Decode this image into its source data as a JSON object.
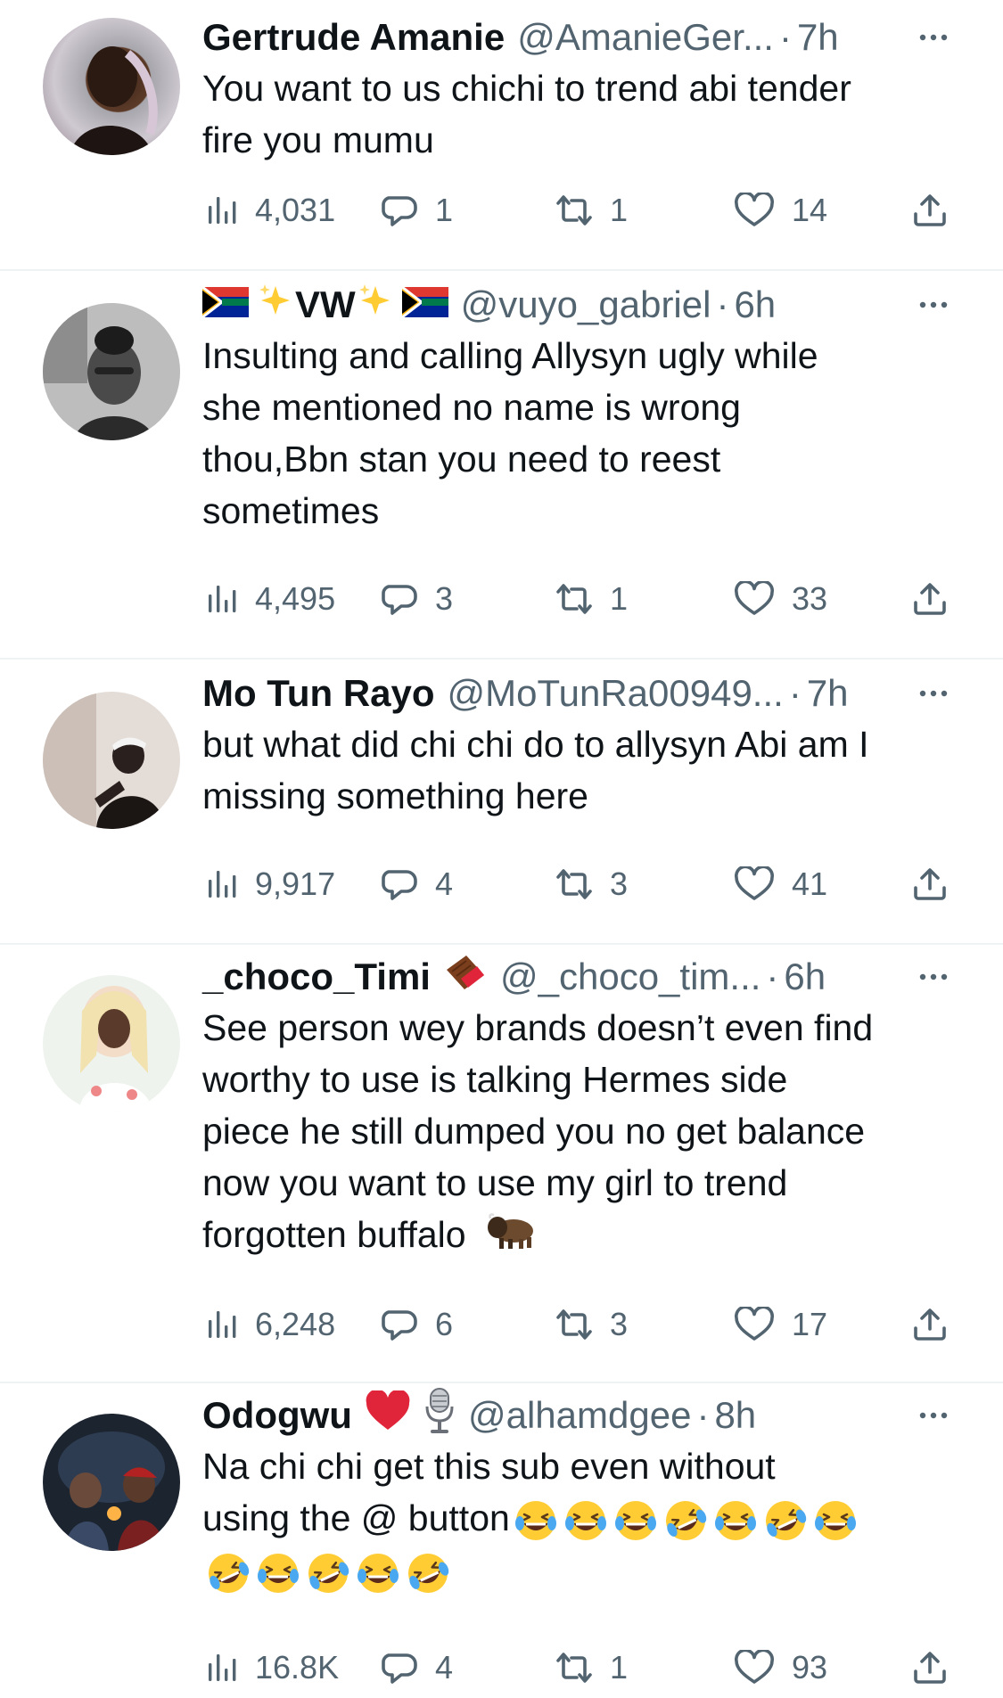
{
  "tweets": [
    {
      "name": "Gertrude Amanie",
      "handle": "@AmanieGer...",
      "time": "7h",
      "text": [
        "You want to us chichi to trend abi tender",
        "fire you mumu"
      ],
      "views": "4,031",
      "replies": "1",
      "retweets": "1",
      "likes": "14"
    },
    {
      "name": "VW",
      "handle": "@vuyo_gabriel",
      "time": "6h",
      "text": [
        "Insulting and calling Allysyn ugly while",
        "she mentioned no name is wrong",
        "thou,Bbn stan you need to reest",
        "sometimes"
      ],
      "views": "4,495",
      "replies": "3",
      "retweets": "1",
      "likes": "33"
    },
    {
      "name": "Mo Tun Rayo",
      "handle": "@MoTunRa00949...",
      "time": "7h",
      "text": [
        "but what did chi chi do to allysyn Abi am I",
        "missing something here"
      ],
      "views": "9,917",
      "replies": "4",
      "retweets": "3",
      "likes": "41"
    },
    {
      "name": "_choco_Timi",
      "handle": "@_choco_tim...",
      "time": "6h",
      "text": [
        "See person wey brands doesn’t even find",
        "worthy to use is talking Hermes side",
        "piece he still dumped you no get balance",
        "now you want to use my girl to trend",
        "forgotten buffalo"
      ],
      "views": "6,248",
      "replies": "6",
      "retweets": "3",
      "likes": "17"
    },
    {
      "name": "Odogwu",
      "handle": "@alhamdgee",
      "time": "8h",
      "text": [
        "Na chi chi get this sub even without",
        "using the @ button"
      ],
      "views": "16.8K",
      "replies": "4",
      "retweets": "1",
      "likes": "93"
    }
  ],
  "colors": {
    "text": "#0f1419",
    "muted": "#536471",
    "divider": "#eff3f4",
    "heart": "#e0245e"
  },
  "icons": [
    "views-icon",
    "reply-icon",
    "retweet-icon",
    "like-icon",
    "share-icon",
    "more-icon"
  ]
}
